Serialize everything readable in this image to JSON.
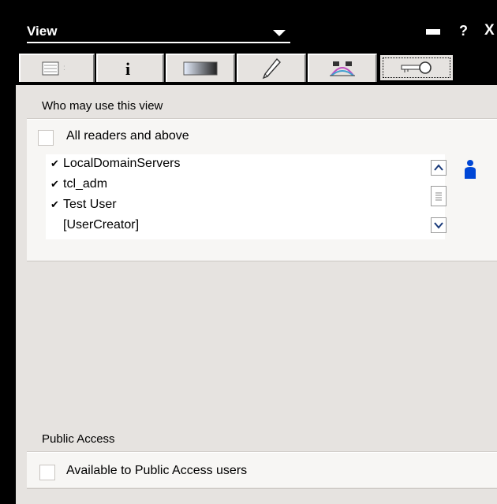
{
  "window": {
    "title": "View",
    "help_glyph": "?",
    "close_glyph": "X"
  },
  "tabs": [
    {
      "name": "info"
    },
    {
      "name": "i"
    },
    {
      "name": "style"
    },
    {
      "name": "fields"
    },
    {
      "name": "options"
    },
    {
      "name": "security",
      "active": true
    }
  ],
  "who_may_use": {
    "header": "Who may use this view",
    "all_readers_label": "All readers and above",
    "all_readers_checked": false,
    "users": [
      {
        "name": "LocalDomainServers",
        "checked": true
      },
      {
        "name": "tcl_adm",
        "checked": true
      },
      {
        "name": "Test User",
        "checked": true
      },
      {
        "name": "[UserCreator]",
        "checked": false
      }
    ],
    "check_glyph": "✔"
  },
  "public_access": {
    "header": "Public Access",
    "label": "Available to Public Access users",
    "checked": false
  },
  "colors": {
    "panel": "#e6e3e0",
    "titlebar": "#000000",
    "person_icon": "#0047d6"
  }
}
